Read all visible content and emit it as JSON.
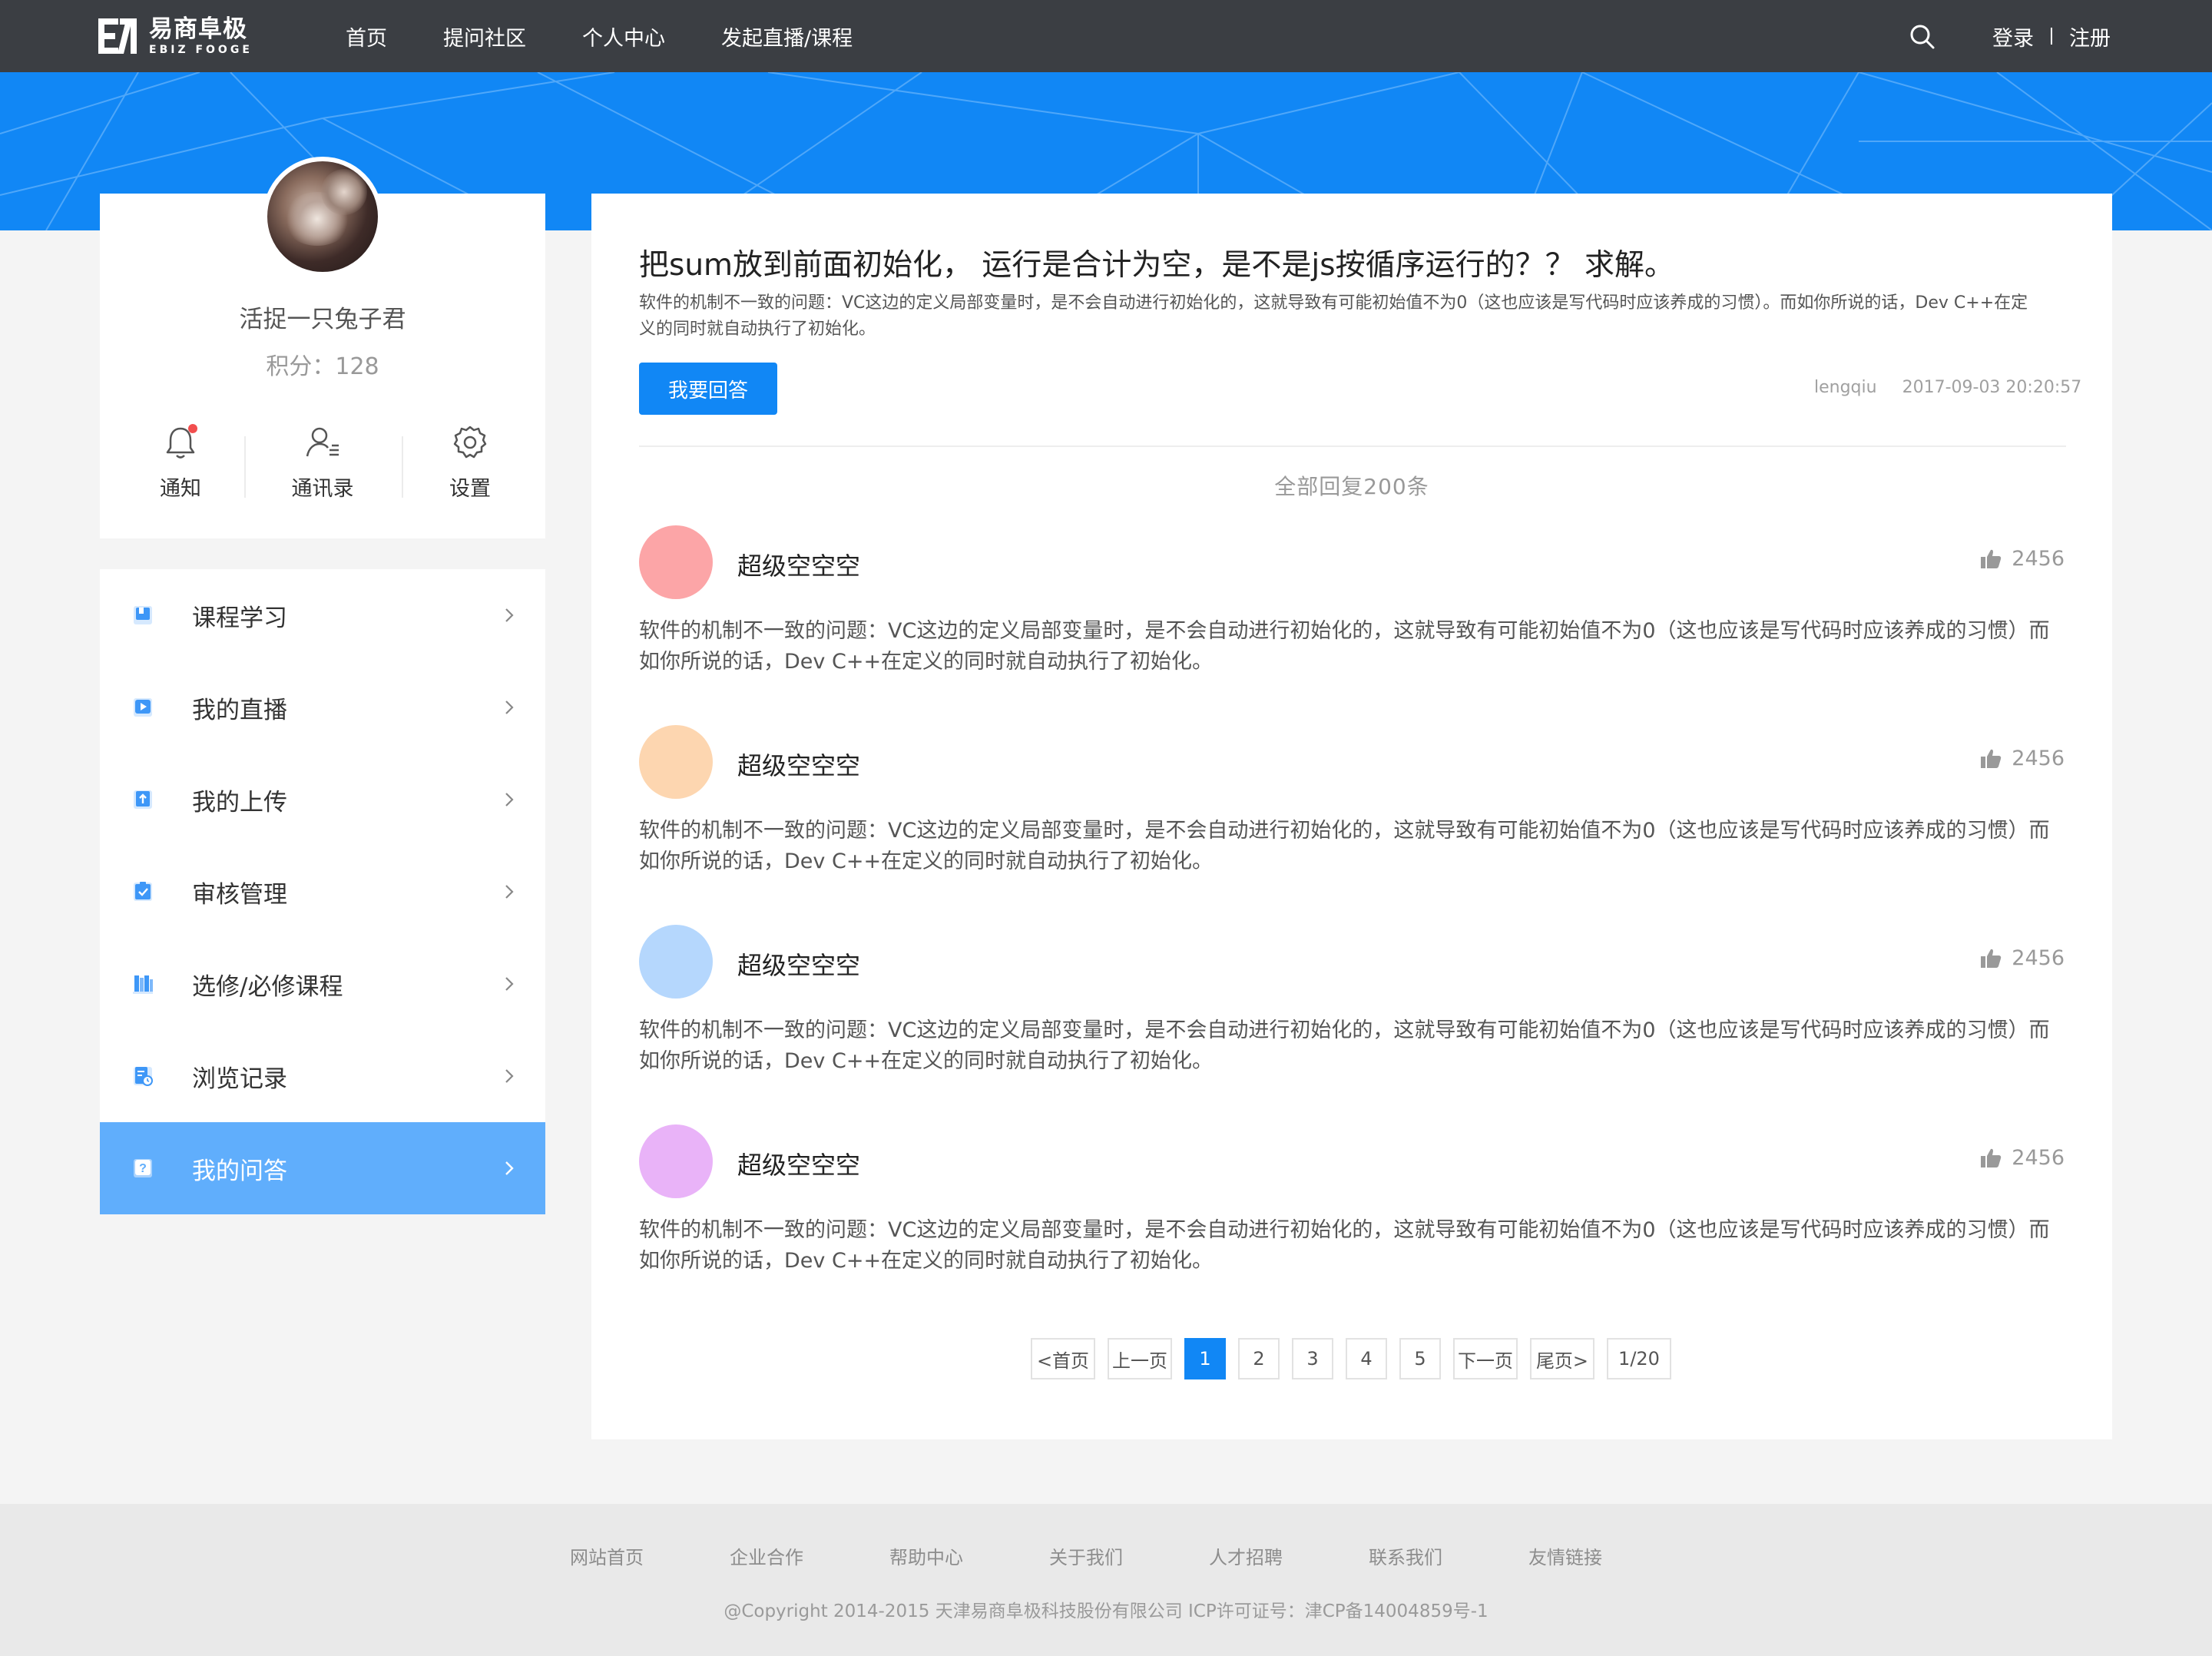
{
  "header": {
    "logo_cn": "易商阜极",
    "logo_en": "EBIZ FOOGE",
    "nav": [
      "首页",
      "提问社区",
      "个人中心",
      "发起直播/课程"
    ],
    "login": "登录",
    "register": "注册"
  },
  "profile": {
    "username": "活捉一只兔子君",
    "points": "积分：128",
    "quick_links": [
      {
        "label": "通知",
        "icon": "bell-icon"
      },
      {
        "label": "通讯录",
        "icon": "contacts-icon"
      },
      {
        "label": "设置",
        "icon": "gear-icon"
      }
    ]
  },
  "menu": {
    "items": [
      {
        "label": "课程学习",
        "icon": "book-icon"
      },
      {
        "label": "我的直播",
        "icon": "play-icon"
      },
      {
        "label": "我的上传",
        "icon": "upload-icon"
      },
      {
        "label": "审核管理",
        "icon": "clipboard-check-icon"
      },
      {
        "label": "选修/必修课程",
        "icon": "books-icon"
      },
      {
        "label": "浏览记录",
        "icon": "history-icon"
      },
      {
        "label": "我的问答",
        "icon": "question-icon"
      }
    ],
    "active_index": 6
  },
  "question": {
    "title": "把sum放到前面初始化， 运行是合计为空，是不是js按循序运行的？？ 求解。",
    "description": "软件的机制不一致的问题：VC这边的定义局部变量时，是不会自动进行初始化的，这就导致有可能初始值不为0（这也应该是写代码时应该养成的习惯）。而如你所说的话，Dev C++在定义的同时就自动执行了初始化。",
    "answer_button": "我要回答",
    "author": "lengqiu",
    "datetime": "2017-09-03 20:20:57",
    "reply_count": "全部回复200条"
  },
  "replies": [
    {
      "name": "超级空空空",
      "likes": "2456",
      "avatar_color": "#fca5a7",
      "text": "软件的机制不一致的问题：VC这边的定义局部变量时，是不会自动进行初始化的，这就导致有可能初始值不为0（这也应该是写代码时应该养成的习惯）而如你所说的话，Dev C++在定义的同时就自动执行了初始化。"
    },
    {
      "name": "超级空空空",
      "likes": "2456",
      "avatar_color": "#fdd6b0",
      "text": "软件的机制不一致的问题：VC这边的定义局部变量时，是不会自动进行初始化的，这就导致有可能初始值不为0（这也应该是写代码时应该养成的习惯）而如你所说的话，Dev C++在定义的同时就自动执行了初始化。"
    },
    {
      "name": "超级空空空",
      "likes": "2456",
      "avatar_color": "#b5d7fd",
      "text": "软件的机制不一致的问题：VC这边的定义局部变量时，是不会自动进行初始化的，这就导致有可能初始值不为0（这也应该是写代码时应该养成的习惯）而如你所说的话，Dev C++在定义的同时就自动执行了初始化。"
    },
    {
      "name": "超级空空空",
      "likes": "2456",
      "avatar_color": "#e9b3f8",
      "text": "软件的机制不一致的问题：VC这边的定义局部变量时，是不会自动进行初始化的，这就导致有可能初始值不为0（这也应该是写代码时应该养成的习惯）而如你所说的话，Dev C++在定义的同时就自动执行了初始化。"
    }
  ],
  "pagination": {
    "first": "<首页",
    "prev": "上一页",
    "pages": [
      "1",
      "2",
      "3",
      "4",
      "5"
    ],
    "current": "1",
    "next": "下一页",
    "last": "尾页>",
    "status": "1/20"
  },
  "footer": {
    "links": [
      "网站首页",
      "企业合作",
      "帮助中心",
      "关于我们",
      "人才招聘",
      "联系我们",
      "友情链接"
    ],
    "copyright": "@Copyright 2014-2015 天津易商阜极科技股份有限公司 ICP许可证号：津CP备14004859号-1"
  },
  "colors": {
    "topbar": "#3b3e43",
    "brand_blue": "#1187f5",
    "active_menu": "#60aefc"
  }
}
